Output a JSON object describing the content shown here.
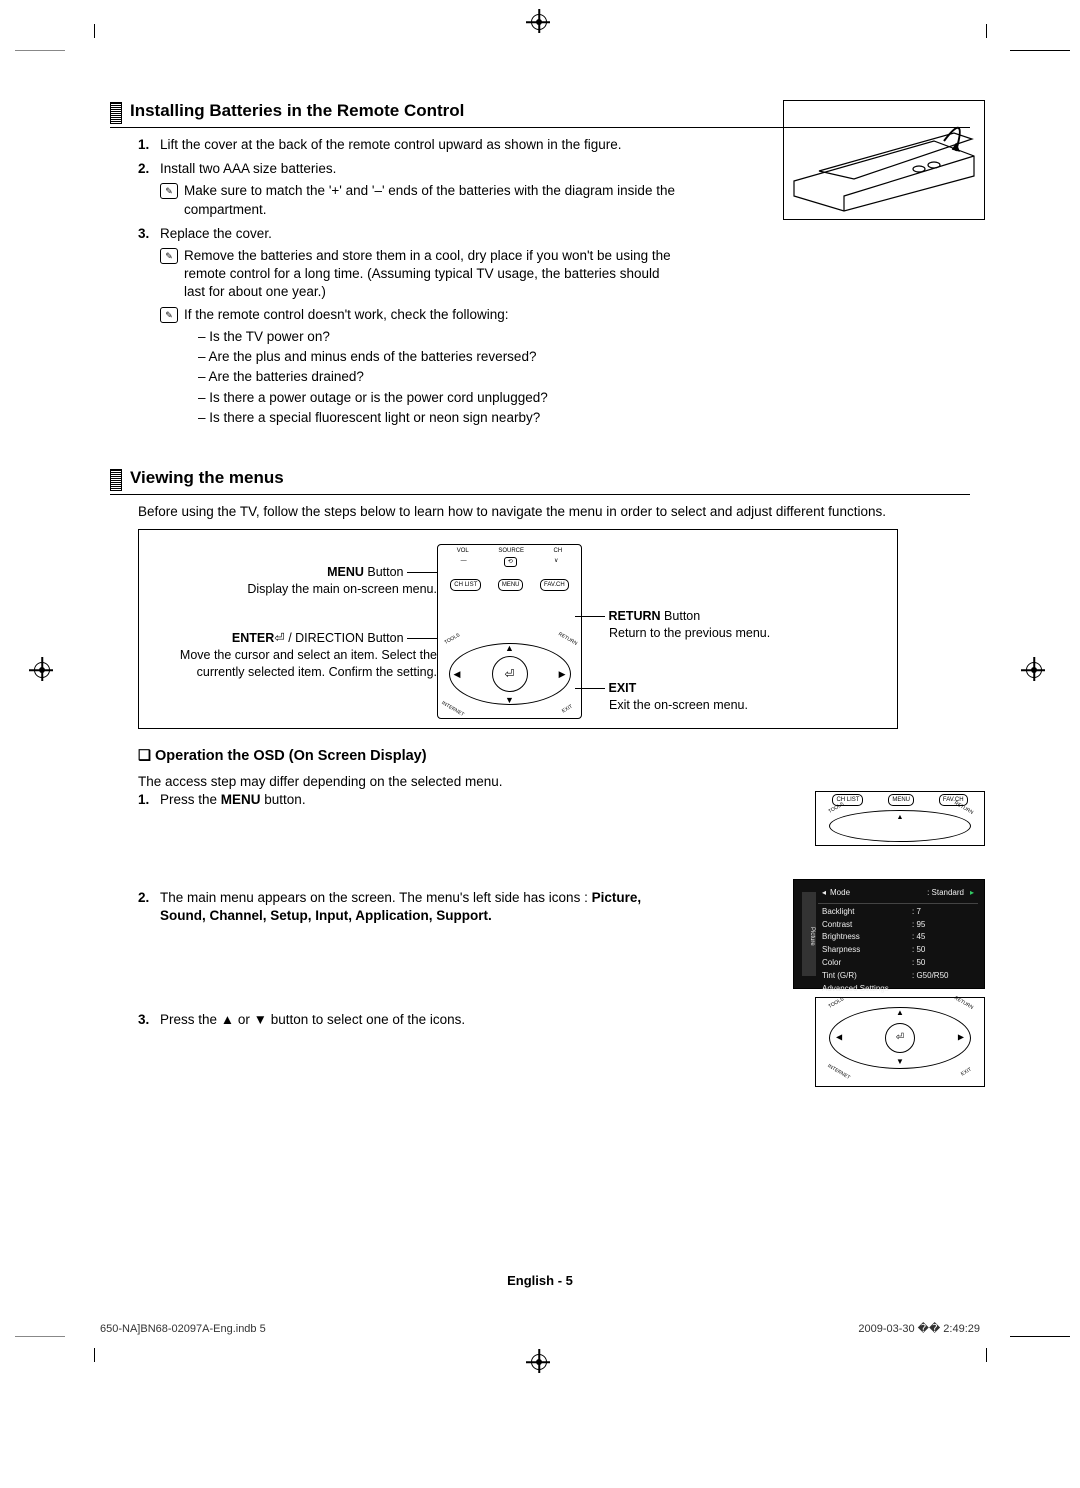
{
  "section1": {
    "title": "Installing Batteries in the Remote Control",
    "step1": "Lift the cover at the back of the remote control upward as shown in the figure.",
    "step2": "Install two AAA size batteries.",
    "step2_note1": "Make sure to match the '+' and '–' ends of the batteries with the diagram inside the compartment.",
    "step3": "Replace the cover.",
    "step3_note1": "Remove the batteries and store them in a cool, dry place if you won't be using the remote control for a long time. (Assuming typical TV usage, the batteries should last for about one year.)",
    "step3_note2": "If the remote control doesn't work, check the following:",
    "checks": [
      "Is the TV power on?",
      "Are the plus and minus ends of the batteries reversed?",
      "Are the batteries drained?",
      "Is there a power outage or is the power cord unplugged?",
      "Is there a special fluorescent light or neon sign nearby?"
    ]
  },
  "section2": {
    "title": "Viewing the menus",
    "intro": "Before using the TV, follow the steps below to learn how to navigate the menu in order to select and adjust different functions.",
    "diagram": {
      "menu_bold": "MENU",
      "menu_label": " Button",
      "menu_desc": "Display the main on-screen menu.",
      "enter_bold": "ENTER",
      "enter_sym": "⏎",
      "enter_label": " / DIRECTION Button",
      "enter_desc": "Move the cursor and select an item. Select the currently selected item. Confirm the setting.",
      "return_bold": "RETURN",
      "return_label": " Button",
      "return_desc": "Return to the previous menu.",
      "exit_bold": "EXIT",
      "exit_desc": "Exit the on-screen menu.",
      "buttons": {
        "top_labels": [
          "VOL",
          "SOURCE",
          "CH"
        ],
        "row2": [
          "CH LIST",
          "MENU",
          "FAV.CH"
        ],
        "ring_corners": [
          "TOOLS",
          "RETURN",
          "INTERNET",
          "EXIT"
        ],
        "center": "⏎"
      }
    },
    "osd": {
      "heading": "Operation the OSD (On Screen Display)",
      "intro": "The access step may differ depending on the selected menu.",
      "step1_prefix": "Press the ",
      "step1_bold": "MENU",
      "step1_suffix": " button.",
      "step2_a": "The main menu appears on the screen. The menu's left side has icons : ",
      "step2_b": "Picture, Sound, Channel, Setup, Input, Application, Support.",
      "step3": "Press the ▲ or ▼ button to select one of the icons.",
      "menu_screenshot": {
        "side": "Picture",
        "header_l": "Mode",
        "header_r": ": Standard",
        "rows": [
          [
            "Backlight",
            ": 7"
          ],
          [
            "Contrast",
            ": 95"
          ],
          [
            "Brightness",
            ": 45"
          ],
          [
            "Sharpness",
            ": 50"
          ],
          [
            "Color",
            ": 50"
          ],
          [
            "Tint (G/R)",
            ": G50/R50"
          ],
          [
            "Advanced Settings",
            ""
          ]
        ]
      },
      "fig2a_btns": [
        "CH LIST",
        "MENU",
        "FAV.CH"
      ]
    }
  },
  "footer": {
    "center": "English - 5",
    "left": "650-NA]BN68-02097A-Eng.indb   5",
    "right": "2009-03-30   �� 2:49:29"
  }
}
